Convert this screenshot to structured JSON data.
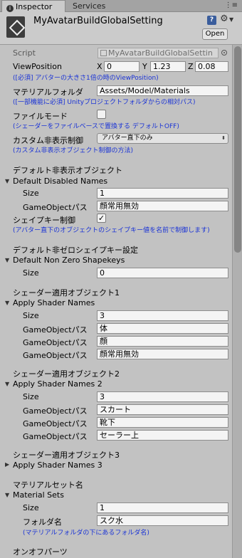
{
  "tabs": {
    "inspector": "Inspector",
    "services": "Services"
  },
  "header": {
    "title": "MyAvatarBuildGlobalSetting",
    "open_label": "Open"
  },
  "script": {
    "label": "Script",
    "value": "MyAvatarBuildGlobalSettin"
  },
  "view_position": {
    "label": "ViewPosition",
    "x_label": "X",
    "x": "0",
    "y_label": "Y",
    "y": "1.23",
    "z_label": "Z",
    "z": "0.08",
    "note": "([必須] アバターの大きさ1倍の時のViewPosition)"
  },
  "material_folder": {
    "label": "マテリアルフォルダ",
    "value": "Assets/Model/Materials",
    "note": "([一部機能に必須] Unityプロジェクトフォルダからの相対パス)"
  },
  "file_mode": {
    "label": "ファイルモード",
    "checked": false,
    "check_mark": "",
    "note": "(シェーダーをファイルベースで置換する デフォルトOFF)"
  },
  "custom_hide": {
    "label": "カスタム非表示制御",
    "value": "アバター直下のみ",
    "note": "(カスタム非表示オブジェクト制御の方法)"
  },
  "default_hidden": {
    "section": "デフォルト非表示オブジェクト",
    "foldout": "Default Disabled Names",
    "size_label": "Size",
    "size": "1",
    "paths": [
      {
        "label": "GameObjectパス",
        "value": "顔常用無効"
      }
    ],
    "shapekey_label": "シェイプキー制御",
    "shapekey_check": "✓",
    "note": "(アバター直下のオブジェクトのシェイプキー値を名前で制御します)"
  },
  "default_nonzero": {
    "section": "デフォルト非ゼロシェイプキー設定",
    "foldout": "Default Non Zero Shapekeys",
    "size_label": "Size",
    "size": "0"
  },
  "shader1": {
    "section": "シェーダー適用オブジェクト1",
    "foldout": "Apply Shader Names",
    "size_label": "Size",
    "size": "3",
    "paths": [
      {
        "label": "GameObjectパス",
        "value": "体"
      },
      {
        "label": "GameObjectパス",
        "value": "顔"
      },
      {
        "label": "GameObjectパス",
        "value": "顔常用無効"
      }
    ]
  },
  "shader2": {
    "section": "シェーダー適用オブジェクト2",
    "foldout": "Apply Shader Names 2",
    "size_label": "Size",
    "size": "3",
    "paths": [
      {
        "label": "GameObjectパス",
        "value": "スカート"
      },
      {
        "label": "GameObjectパス",
        "value": "靴下"
      },
      {
        "label": "GameObjectパス",
        "value": "セーラー上"
      }
    ]
  },
  "shader3": {
    "section": "シェーダー適用オブジェクト3",
    "foldout": "Apply Shader Names 3"
  },
  "material_sets": {
    "section": "マテリアルセット名",
    "foldout": "Material Sets",
    "size_label": "Size",
    "size": "1",
    "folder_label": "フォルダ名",
    "folder_value": "スク水",
    "note": "(マテリアルフォルダの下にあるフォルダ名)"
  },
  "onoff": {
    "section": "オンオフパーツ"
  },
  "icons": {
    "info": "info-icon",
    "gear": "gear-icon",
    "help": "help-icon",
    "menu": "menu-icon",
    "foldout_open": "triangle-down-icon",
    "foldout_closed": "triangle-right-icon"
  }
}
